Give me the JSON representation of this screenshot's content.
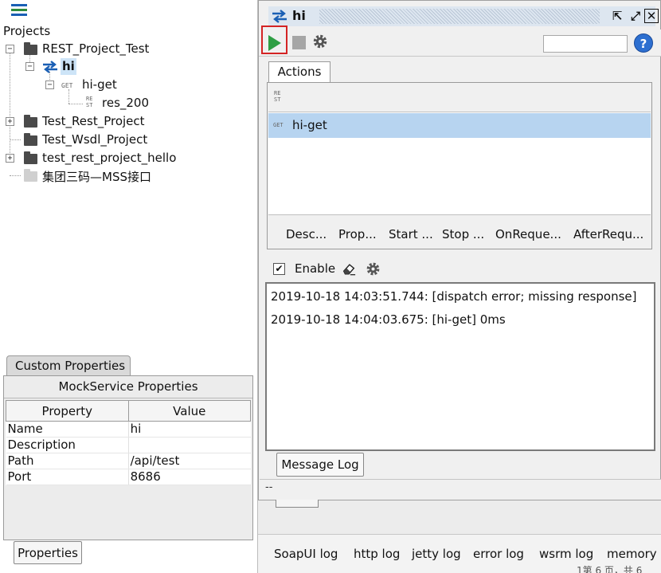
{
  "navigator": {
    "root_label": "Projects",
    "tree": [
      {
        "label": "REST_Project_Test"
      },
      {
        "label": "hi"
      },
      {
        "label": "hi-get",
        "tag": "GET"
      },
      {
        "label": "res_200",
        "tag_top": "RE",
        "tag_bottom": "ST"
      },
      {
        "label": "Test_Rest_Project"
      },
      {
        "label": "Test_Wsdl_Project"
      },
      {
        "label": "test_rest_project_hello"
      },
      {
        "label": "集团三码—MSS接口"
      }
    ],
    "expanders": {
      "open": "−",
      "closed": "+"
    }
  },
  "properties_panel": {
    "tab": "Custom Properties",
    "title": "MockService Properties",
    "columns": [
      "Property",
      "Value"
    ],
    "rows": [
      {
        "property": "Name",
        "value": "hi"
      },
      {
        "property": "Description",
        "value": ""
      },
      {
        "property": "Path",
        "value": "/api/test"
      },
      {
        "property": "Port",
        "value": "8686"
      }
    ],
    "bottom_button": "Properties"
  },
  "mock_window": {
    "title": "hi",
    "controls": {
      "detach": "⇱",
      "maximize": "⤢",
      "close": "✕"
    },
    "help_label": "?",
    "search_value": "",
    "actions_tab": "Actions",
    "rest_tag_top": "RE",
    "rest_tag_bottom": "ST",
    "actions": [
      {
        "method": "GET",
        "label": "hi-get"
      }
    ],
    "script_tabs": [
      "Desc...",
      "Prop...",
      "Start ...",
      "Stop ...",
      "OnReque...",
      "AfterRequ..."
    ],
    "enable_label": "Enable",
    "enable_checked": true,
    "log_lines": [
      "2019-10-18 14:03:51.744: [dispatch error; missing response]",
      "2019-10-18 14:04:03.675: [hi-get] 0ms"
    ],
    "message_log_button": "Message Log",
    "status_text": "--"
  },
  "log_tabs": [
    "SoapUI log",
    "http log",
    "jetty log",
    "error log",
    "wsrm log",
    "memory l"
  ],
  "cut_text": "1第 6 页，共 6",
  "colors": {
    "play": "#2f9e44",
    "highlight": "#d42424",
    "selection": "#b7d4f0",
    "help": "#2d6fd0"
  }
}
